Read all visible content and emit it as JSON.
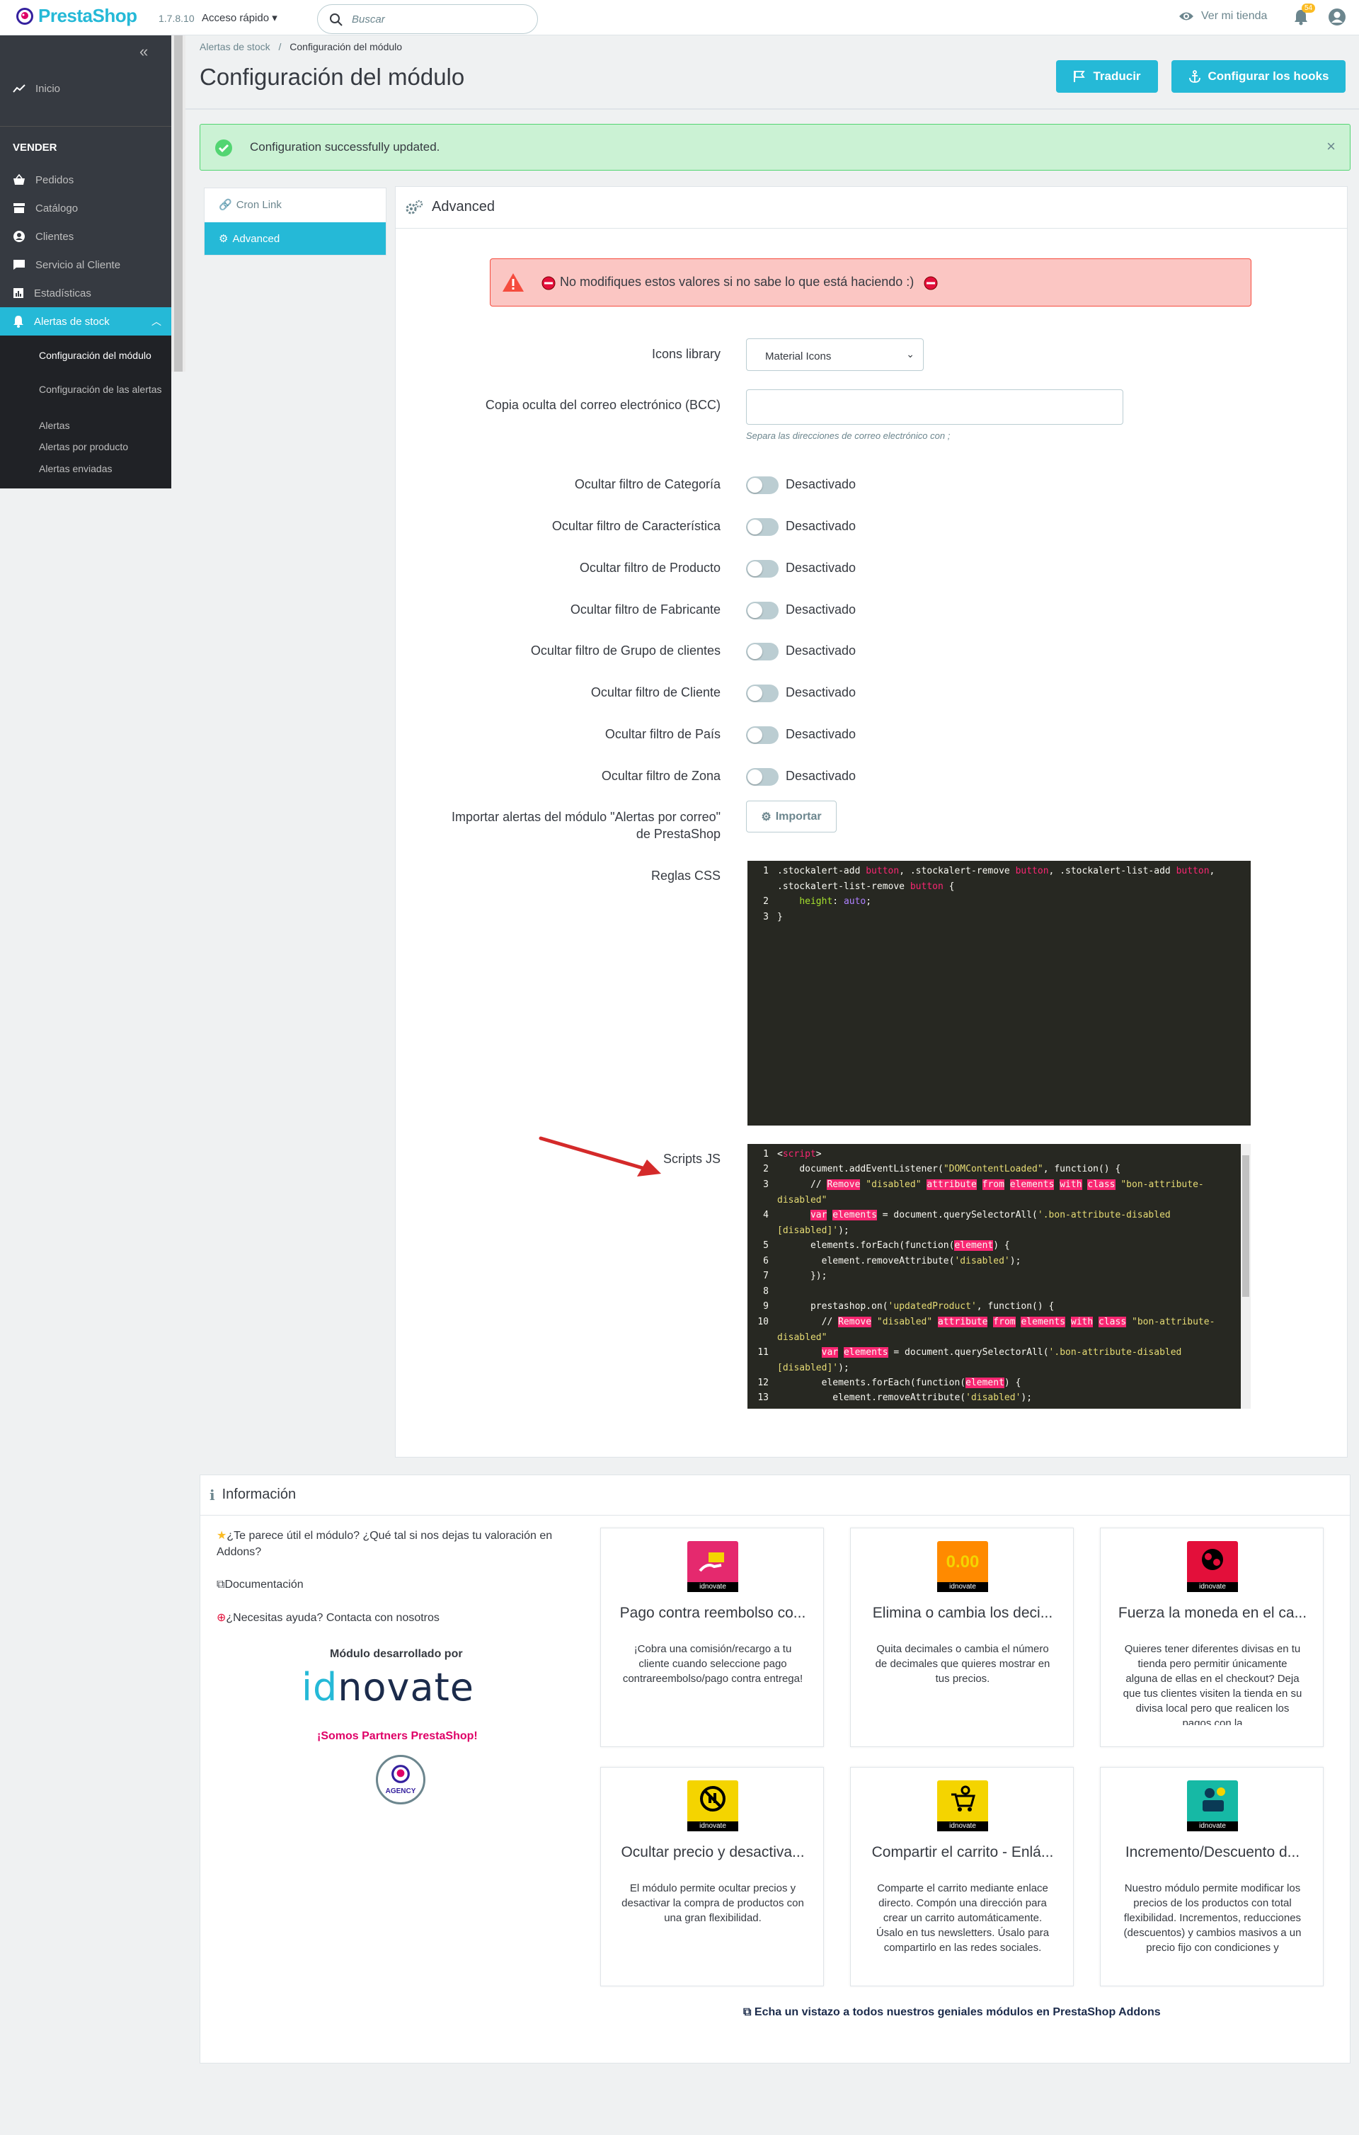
{
  "topbar": {
    "logo": "PrestaShop",
    "version": "1.7.8.10",
    "quick_access": "Acceso rápido",
    "search_placeholder": "Buscar",
    "view_store": "Ver mi tienda",
    "notifications": "54"
  },
  "sidebar": {
    "home": "Inicio",
    "section": "VENDER",
    "items": [
      "Pedidos",
      "Catálogo",
      "Clientes",
      "Servicio al Cliente",
      "Estadísticas",
      "Alertas de stock"
    ],
    "subitems": [
      "Configuración del módulo",
      "Configuración de las alertas",
      "Alertas",
      "Alertas por producto",
      "Alertas enviadas"
    ]
  },
  "header": {
    "breadcrumb": [
      "Alertas de stock",
      "Configuración del módulo"
    ],
    "title": "Configuración del módulo",
    "btn_translate": "Traducir",
    "btn_hooks": "Configurar los hooks"
  },
  "success_message": "Configuration successfully updated.",
  "tabs": [
    "Cron Link",
    "Advanced"
  ],
  "panel": {
    "title": "Advanced",
    "warning": "No modifiques estos valores si no sabe lo que está haciendo :)",
    "icons_library_label": "Icons library",
    "icons_library_value": "Material Icons",
    "bcc_label": "Copia oculta del correo electrónico (BCC)",
    "bcc_value": "",
    "bcc_help": "Separa las direcciones de correo electrónico con ;",
    "toggles": [
      {
        "label": "Ocultar filtro de Categoría",
        "state": "Desactivado"
      },
      {
        "label": "Ocultar filtro de Característica",
        "state": "Desactivado"
      },
      {
        "label": "Ocultar filtro de Producto",
        "state": "Desactivado"
      },
      {
        "label": "Ocultar filtro de Fabricante",
        "state": "Desactivado"
      },
      {
        "label": "Ocultar filtro de Grupo de clientes",
        "state": "Desactivado"
      },
      {
        "label": "Ocultar filtro de Cliente",
        "state": "Desactivado"
      },
      {
        "label": "Ocultar filtro de País",
        "state": "Desactivado"
      },
      {
        "label": "Ocultar filtro de Zona",
        "state": "Desactivado"
      }
    ],
    "import_label": "Importar alertas del módulo \"Alertas por correo\" de PrestaShop",
    "import_button": "Importar",
    "css_label": "Reglas CSS",
    "js_label": "Scripts JS",
    "css_lines": [
      "1",
      "2",
      "3"
    ],
    "js_lines": [
      "1",
      "2",
      "3",
      "4",
      "5",
      "6",
      "7",
      "8",
      "9",
      "10",
      "11",
      "12",
      "13"
    ]
  },
  "info": {
    "title": "Información",
    "rate_link": "¿Te parece útil el módulo? ¿Qué tal si nos dejas tu valoración en Addons?",
    "doc_link": "Documentación",
    "help_link": "¿Necesitas ayuda? Contacta con nosotros",
    "developed_by": "Módulo desarrollado por",
    "brand": "idnovate",
    "partners": "¡Somos Partners PrestaShop!",
    "badge": "AGENCY",
    "footer_link": "Echa un vistazo a todos nuestros geniales módulos en PrestaShop Addons",
    "cards": [
      {
        "title": "Pago contra reembolso co...",
        "desc": "¡Cobra una comisión/recargo a tu cliente cuando seleccione pago contrareembolso/pago contra entrega!",
        "color": "#e5296e",
        "icon_text": ""
      },
      {
        "title": "Elimina o cambia los deci...",
        "desc": "Quita decimales o cambia el número de decimales que quieres mostrar en tus precios.",
        "color": "#ff8a00",
        "icon_text": "0.00"
      },
      {
        "title": "Fuerza la moneda en el ca...",
        "desc": "Quieres tener diferentes divisas en tu tienda pero permitir únicamente alguna de ellas en el checkout? Deja que tus clientes visiten la tienda en su divisa local pero que realicen los pagos con la",
        "color": "#e30f3a",
        "icon_text": ""
      },
      {
        "title": "Ocultar precio y desactiva...",
        "desc": "El módulo permite ocultar precios y desactivar la compra de productos con una gran flexibilidad.",
        "color": "#f4d400",
        "icon_text": ""
      },
      {
        "title": "Compartir el carrito - Enlá...",
        "desc": "Comparte el carrito mediante enlace directo. Compón una dirección para crear un carrito automáticamente. Úsalo en tus newsletters. Úsalo para compartirlo en las redes sociales.",
        "color": "#f4d400",
        "icon_text": ""
      },
      {
        "title": "Incremento/Descuento d...",
        "desc": "Nuestro módulo permite modificar los precios de los productos con total flexibilidad. Incrementos, reducciones (descuentos) y cambios masivos a un precio fijo con condiciones y",
        "color": "#16b9a5",
        "icon_text": ""
      }
    ]
  }
}
